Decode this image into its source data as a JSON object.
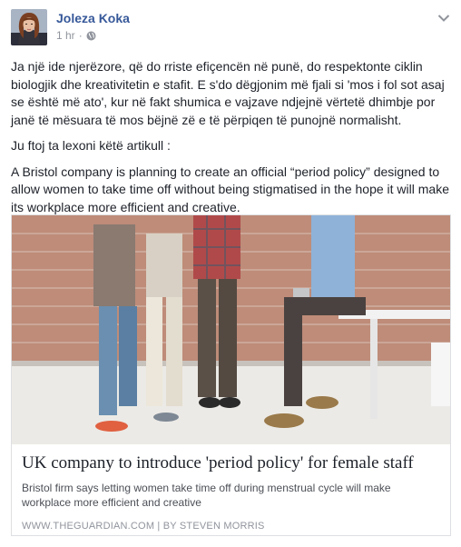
{
  "post": {
    "author": "Joleza Koka",
    "time": "1 hr",
    "separator": "·",
    "privacy_icon": "globe-icon",
    "menu_icon": "chevron-down-icon",
    "paragraphs": [
      "Ja një ide njerëzore, që do rriste efiçencën në punë, do respektonte ciklin biologjik dhe kreativitetin e stafit. E s'do dëgjonim më fjali si 'mos i fol sot asaj se është më ato', kur në fakt shumica e vajzave ndjejnë vërtetë dhimbje por janë të mësuara të mos bëjnë zë e të përpiqen të punojnë normalisht.",
      "Ju ftoj ta lexoni këtë artikull :",
      "A Bristol company is planning to create an official “period policy” designed to allow women to take time off without being stigmatised in the hope it will make its workplace more efficient and creative."
    ]
  },
  "link_card": {
    "title": "UK company to introduce 'period policy' for female staff",
    "description": "Bristol firm says letting women take time off during menstrual cycle will make workplace more efficient and creative",
    "source": "WWW.THEGUARDIAN.COM | BY STEVEN MORRIS"
  },
  "colors": {
    "author": "#365899",
    "meta": "#90949c",
    "text": "#1d2129",
    "border": "#dddfe2"
  }
}
